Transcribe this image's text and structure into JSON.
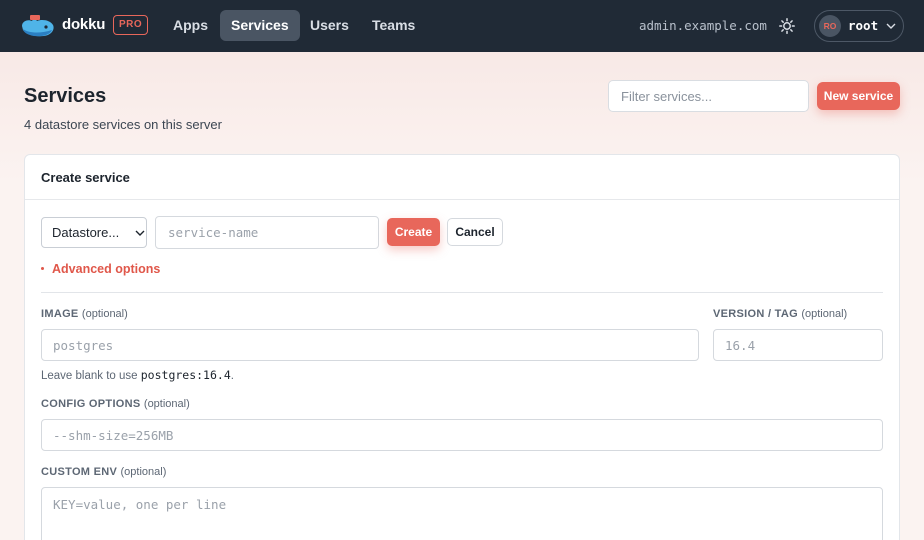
{
  "brand": {
    "name": "dokku",
    "badge": "PRO"
  },
  "nav": {
    "tabs": [
      "Apps",
      "Services",
      "Users",
      "Teams"
    ],
    "active": "Services"
  },
  "header": {
    "host": "admin.example.com",
    "user_initials": "RO",
    "user_name": "root"
  },
  "page": {
    "title": "Services",
    "subtitle": "4 datastore services on this server",
    "filter_placeholder": "Filter services...",
    "new_button": "New service"
  },
  "create_card": {
    "title": "Create service",
    "datastore_select": "Datastore...",
    "name_placeholder": "service-name",
    "create_button": "Create",
    "cancel_button": "Cancel",
    "advanced_toggle": "Advanced options",
    "image": {
      "label": "IMAGE",
      "optional": "(optional)",
      "placeholder": "postgres"
    },
    "version": {
      "label": "VERSION / TAG",
      "optional": "(optional)",
      "placeholder": "16.4"
    },
    "hint": {
      "prefix": "Leave blank to use ",
      "code": "postgres:16.4",
      "suffix": "."
    },
    "config": {
      "label": "CONFIG OPTIONS",
      "optional": "(optional)",
      "placeholder": "--shm-size=256MB"
    },
    "env": {
      "label": "CUSTOM ENV",
      "optional": "(optional)",
      "placeholder": "KEY=value, one per line"
    }
  },
  "colors": {
    "accent": "#e8675b",
    "topbar": "#202a36"
  },
  "icons": {
    "logo": "whale-logo-icon",
    "theme": "sun-icon",
    "menu": "chevron-down-icon"
  }
}
